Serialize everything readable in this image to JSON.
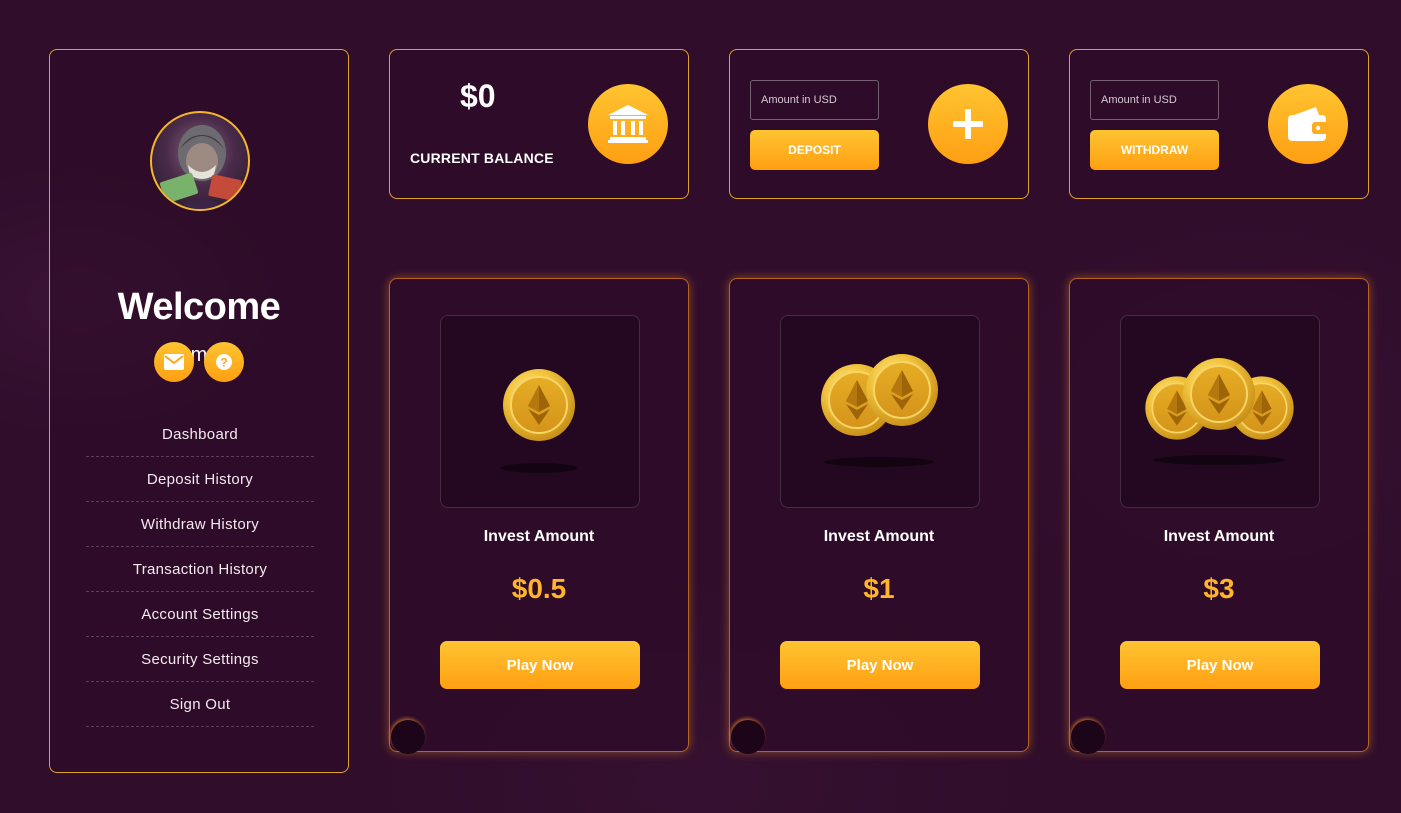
{
  "colors": {
    "accent": "#ffb42a",
    "button_gradient": [
      "#ffc431",
      "#ff9f12"
    ],
    "border": "#e0a12a",
    "background": "#2f0d2b"
  },
  "sidebar": {
    "avatar_icon": "user-avatar",
    "welcome": "Welcome",
    "username": "human",
    "actions": [
      {
        "icon": "envelope-icon"
      },
      {
        "icon": "question-icon"
      }
    ],
    "nav": [
      "Dashboard",
      "Deposit History",
      "Withdraw History",
      "Transaction History",
      "Account Settings",
      "Security Settings",
      "Sign Out"
    ]
  },
  "balance": {
    "value": "$0",
    "label": "CURRENT BALANCE",
    "icon": "bank-icon"
  },
  "deposit": {
    "placeholder": "Amount in USD",
    "button": "DEPOSIT",
    "icon": "plus-icon"
  },
  "withdraw": {
    "placeholder": "Amount in USD",
    "button": "WITHDRAW",
    "icon": "wallet-icon"
  },
  "plans": [
    {
      "label": "Invest Amount",
      "amount": "$0.5",
      "button": "Play Now",
      "coin_count": 1
    },
    {
      "label": "Invest Amount",
      "amount": "$1",
      "button": "Play Now",
      "coin_count": 2
    },
    {
      "label": "Invest Amount",
      "amount": "$3",
      "button": "Play Now",
      "coin_count": 3
    }
  ]
}
